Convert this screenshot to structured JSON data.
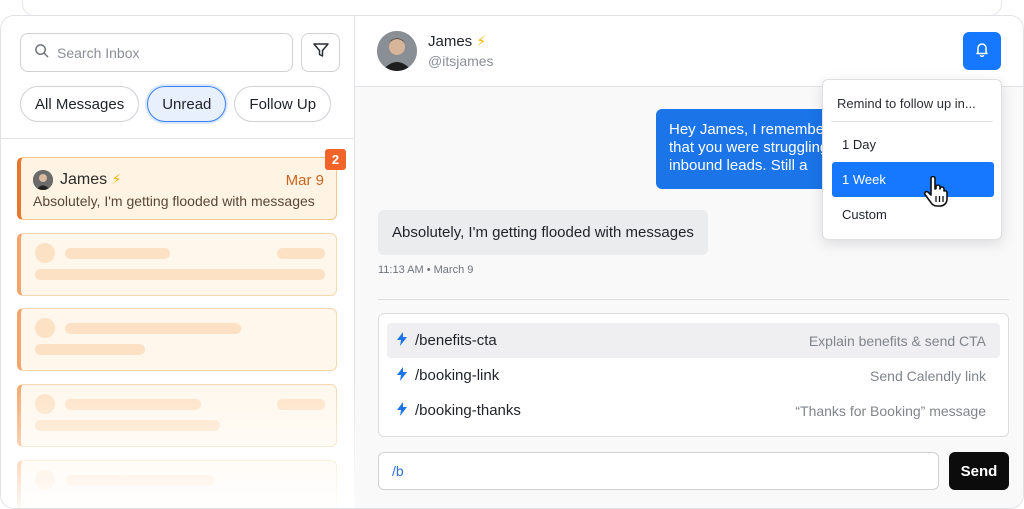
{
  "search": {
    "placeholder": "Search Inbox"
  },
  "tabs": [
    {
      "label": "All Messages",
      "active": false
    },
    {
      "label": "Unread",
      "active": true
    },
    {
      "label": "Follow Up",
      "active": false
    }
  ],
  "thread": {
    "name": "James",
    "date": "Mar 9",
    "preview": "Absolutely, I'm getting flooded with messages",
    "badge": "2"
  },
  "conversation": {
    "contact_name": "James",
    "contact_handle": "@itsjames",
    "outgoing_message": [
      "Hey James, I remember",
      "that you were struggling",
      "inbound leads. Still a"
    ],
    "incoming_message": "Absolutely, I'm getting flooded with messages",
    "incoming_meta": "11:13 AM • March 9"
  },
  "reminder_menu": {
    "header": "Remind to follow up in...",
    "options": [
      {
        "label": "1 Day",
        "selected": false
      },
      {
        "label": "1 Week",
        "selected": true
      },
      {
        "label": "Custom",
        "selected": false
      }
    ]
  },
  "snippets": [
    {
      "command": "/benefits-cta",
      "description": "Explain benefits & send CTA",
      "highlighted": true
    },
    {
      "command": "/booking-link",
      "description": "Send Calendly link",
      "highlighted": false
    },
    {
      "command": "/booking-thanks",
      "description": "“Thanks for Booking” message",
      "highlighted": false
    }
  ],
  "composer": {
    "value": "/b",
    "send_label": "Send"
  },
  "icons": {
    "search": "search-icon",
    "filter": "funnel-icon",
    "bell": "bell-icon",
    "bolt": "lightning-icon",
    "cursor": "hand-pointer-icon"
  },
  "colors": {
    "accent_blue": "#1677ff",
    "thread_orange": "#e8762c",
    "badge": "#f0642a",
    "outgoing_bubble": "#1b74e8",
    "send_button": "#0c0c0c"
  }
}
